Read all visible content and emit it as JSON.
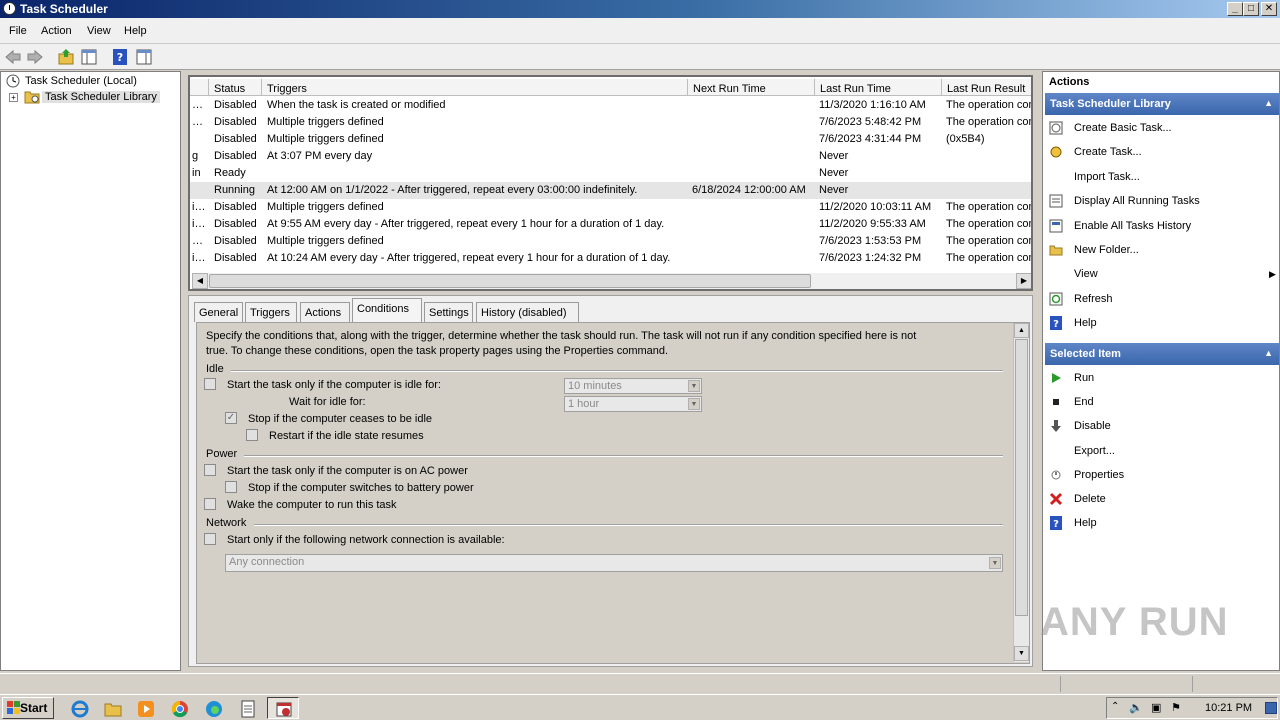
{
  "window": {
    "title": "Task Scheduler"
  },
  "window_buttons": {
    "minimize": "_",
    "maximize": "□",
    "close": "✕"
  },
  "menu": [
    "File",
    "Action",
    "View",
    "Help"
  ],
  "toolbar_icons": [
    "back-arrow-icon",
    "forward-arrow-icon",
    "up-folder-icon",
    "show-hide-tree-icon",
    "help-icon",
    "show-hide-action-pane-icon"
  ],
  "tree": {
    "root": "Task Scheduler (Local)",
    "child": "Task Scheduler Library",
    "expand_glyph": "+"
  },
  "tasklist": {
    "columns": [
      "Status",
      "Triggers",
      "Next Run Time",
      "Last Run Time",
      "Last Run Result"
    ],
    "rows": [
      {
        "name": "…",
        "status": "Disabled",
        "triggers": "When the task is created or modified",
        "next": "",
        "last": "11/3/2020 1:16:10 AM",
        "result": "The operation com",
        "selected": false
      },
      {
        "name": "…",
        "status": "Disabled",
        "triggers": "Multiple triggers defined",
        "next": "",
        "last": "7/6/2023 5:48:42 PM",
        "result": "The operation com",
        "selected": false
      },
      {
        "name": "",
        "status": "Disabled",
        "triggers": "Multiple triggers defined",
        "next": "",
        "last": "7/6/2023 4:31:44 PM",
        "result": "(0x5B4)",
        "selected": false
      },
      {
        "name": "g",
        "status": "Disabled",
        "triggers": "At 3:07 PM every day",
        "next": "",
        "last": "Never",
        "result": "",
        "selected": false
      },
      {
        "name": "in",
        "status": "Ready",
        "triggers": "",
        "next": "",
        "last": "Never",
        "result": "",
        "selected": false
      },
      {
        "name": "",
        "status": "Running",
        "triggers": "At 12:00 AM on 1/1/2022 - After triggered, repeat every 03:00:00 indefinitely.",
        "next": "6/18/2024 12:00:00 AM",
        "last": "Never",
        "result": "",
        "selected": true
      },
      {
        "name": "i…",
        "status": "Disabled",
        "triggers": "Multiple triggers defined",
        "next": "",
        "last": "11/2/2020 10:03:11 AM",
        "result": "The operation com",
        "selected": false
      },
      {
        "name": "i…",
        "status": "Disabled",
        "triggers": "At 9:55 AM every day - After triggered, repeat every 1 hour for a duration of 1 day.",
        "next": "",
        "last": "11/2/2020 9:55:33 AM",
        "result": "The operation com",
        "selected": false
      },
      {
        "name": "…",
        "status": "Disabled",
        "triggers": "Multiple triggers defined",
        "next": "",
        "last": "7/6/2023 1:53:53 PM",
        "result": "The operation com",
        "selected": false
      },
      {
        "name": "i…",
        "status": "Disabled",
        "triggers": "At 10:24 AM every day - After triggered, repeat every 1 hour for a duration of 1 day.",
        "next": "",
        "last": "7/6/2023 1:24:32 PM",
        "result": "The operation com",
        "selected": false
      }
    ]
  },
  "tabs": [
    "General",
    "Triggers",
    "Actions",
    "Conditions",
    "Settings",
    "History (disabled)"
  ],
  "active_tab": "Conditions",
  "conditions": {
    "intro_line1": "Specify the conditions that, along with the trigger, determine whether the task should run.  The task will not run  if any condition specified here is not",
    "intro_line2": "true.  To change these conditions, open the task property pages using the Properties command.",
    "idle_group": "Idle",
    "idle_start": "Start the task only if the computer is idle for:",
    "idle_for_value": "10 minutes",
    "wait_label": "Wait for idle for:",
    "wait_value": "1 hour",
    "stop_idle": "Stop if the computer ceases to be idle",
    "restart_idle": "Restart if the idle state resumes",
    "power_group": "Power",
    "ac_power": "Start the task only if the computer is on AC power",
    "battery": "Stop if the computer switches to battery power",
    "wake": "Wake the computer to run this task",
    "network_group": "Network",
    "network_start": "Start only if the following network connection is available:",
    "network_value": "Any connection",
    "checks": {
      "idle_start": false,
      "stop_idle": true,
      "restart_idle": false,
      "ac_power": false,
      "battery": false,
      "wake": false,
      "network_start": false
    }
  },
  "actions_pane": {
    "title": "Actions",
    "section1": "Task Scheduler Library",
    "items1": [
      {
        "label": "Create Basic Task...",
        "icon": "create-basic-task-icon"
      },
      {
        "label": "Create Task...",
        "icon": "create-task-icon"
      },
      {
        "label": "Import Task...",
        "icon": ""
      },
      {
        "label": "Display All Running Tasks",
        "icon": "running-tasks-icon"
      },
      {
        "label": "Enable All Tasks History",
        "icon": "history-icon"
      },
      {
        "label": "New Folder...",
        "icon": "folder-icon"
      },
      {
        "label": "View",
        "icon": ""
      },
      {
        "label": "Refresh",
        "icon": "refresh-icon"
      },
      {
        "label": "Help",
        "icon": "help-icon"
      }
    ],
    "section2": "Selected Item",
    "items2": [
      {
        "label": "Run",
        "icon": "run-icon"
      },
      {
        "label": "End",
        "icon": "end-icon"
      },
      {
        "label": "Disable",
        "icon": "disable-icon"
      },
      {
        "label": "Export...",
        "icon": ""
      },
      {
        "label": "Properties",
        "icon": "properties-icon"
      },
      {
        "label": "Delete",
        "icon": "delete-icon"
      },
      {
        "label": "Help",
        "icon": "help-icon"
      }
    ]
  },
  "taskbar": {
    "start": "Start",
    "clock": "10:21 PM",
    "apps": [
      "internet-explorer-icon",
      "explorer-folder-icon",
      "media-player-icon",
      "chrome-icon",
      "edge-icon",
      "notepad-icon",
      "task-scheduler-icon"
    ]
  },
  "watermark": "ANY RUN",
  "colors": {
    "accent": "#3a66ad",
    "title": "#0a246a",
    "selected_row": "#e5e5e5"
  }
}
